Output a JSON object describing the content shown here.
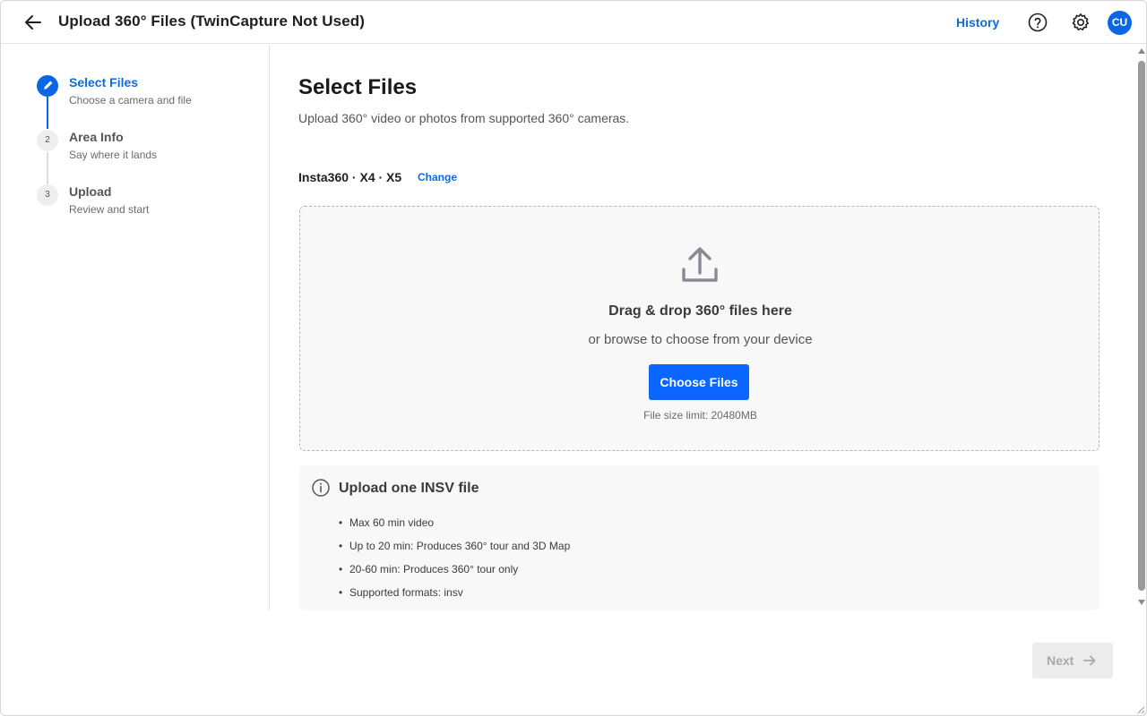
{
  "header": {
    "title": "Upload 360° Files (TwinCapture Not Used)",
    "history_label": "History",
    "avatar_initials": "CU"
  },
  "steps": [
    {
      "number": "1",
      "title": "Select Files",
      "subtitle": "Choose a camera and file",
      "state": "active"
    },
    {
      "number": "2",
      "title": "Area Info",
      "subtitle": "Say where it lands",
      "state": "pending"
    },
    {
      "number": "3",
      "title": "Upload",
      "subtitle": "Review and start",
      "state": "pending"
    }
  ],
  "main": {
    "title": "Select Files",
    "description": "Upload 360° video or photos from supported 360° cameras.",
    "camera": {
      "name": "Insta360 · X4 · X5",
      "change_label": "Change"
    },
    "dropzone": {
      "title": "Drag & drop 360° files here",
      "subtitle": "or browse to choose from your device",
      "button_label": "Choose Files",
      "limit": "File size limit: 20480MB"
    },
    "info": {
      "title": "Upload one INSV file",
      "bullets": [
        "Max 60 min video",
        "Up to 20 min: Produces 360° tour and 3D Map",
        "20-60 min: Produces 360° tour only",
        "Supported formats: insv"
      ]
    }
  },
  "footer": {
    "next_label": "Next"
  },
  "colors": {
    "accent": "#0a66e4",
    "link": "#0f6bd6",
    "primary_button": "#0a66ff",
    "disabled_bg": "#ececec"
  },
  "icons": {
    "back": "arrow-left-icon",
    "help": "help-circle-icon",
    "settings": "gear-icon",
    "step_active": "pencil-icon",
    "upload": "upload-icon",
    "info": "info-icon",
    "next": "arrow-right-icon"
  }
}
